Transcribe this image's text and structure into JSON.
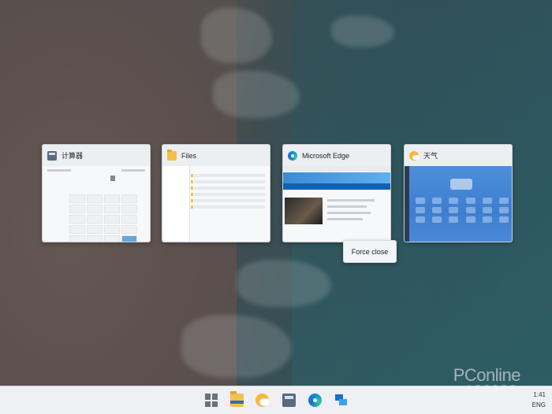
{
  "windows": [
    {
      "title": "计算器",
      "icon": "calculator-icon"
    },
    {
      "title": "Files",
      "icon": "folder-icon"
    },
    {
      "title": "Microsoft Edge",
      "icon": "edge-icon"
    },
    {
      "title": "天气",
      "icon": "weather-icon"
    }
  ],
  "context_menu": {
    "item": "Force close"
  },
  "taskbar": {
    "apps": [
      "start-icon",
      "folder-icon",
      "weather-icon",
      "calculator-icon",
      "edge-icon",
      "store-icon"
    ],
    "time": "1:41",
    "lang": "ENG"
  },
  "watermark": {
    "text": "PConline",
    "sub": "太平洋电脑网"
  },
  "colors": {
    "accent": "#1b6fc9",
    "taskbar_bg": "#eef0f3",
    "card_bg": "#eceff2"
  }
}
